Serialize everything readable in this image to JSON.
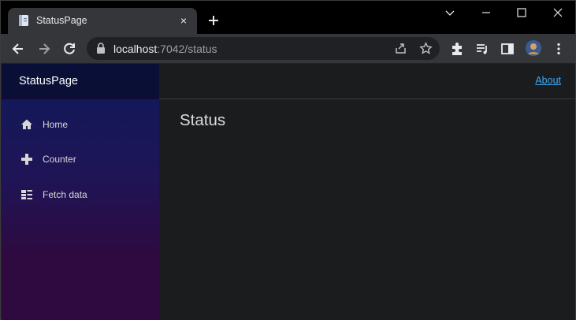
{
  "browser": {
    "tab": {
      "title": "StatusPage",
      "close_glyph": "×"
    },
    "address": {
      "host": "localhost",
      "path": ":7042/status"
    },
    "icons": {
      "favicon": "page-icon",
      "newtab": "plus-icon",
      "back": "arrow-left-icon",
      "forward": "arrow-right-icon",
      "reload": "reload-icon",
      "lock": "lock-icon",
      "share": "share-icon",
      "bookmark": "star-icon",
      "extensions": "puzzle-icon",
      "reading_list": "reading-list-icon",
      "side_panel": "side-panel-icon",
      "menu": "kebab-menu-icon"
    }
  },
  "app": {
    "brand": "StatusPage",
    "nav": [
      {
        "label": "Home",
        "icon": "home-icon"
      },
      {
        "label": "Counter",
        "icon": "plus-icon"
      },
      {
        "label": "Fetch data",
        "icon": "list-icon"
      }
    ],
    "top_link": "About",
    "page_title": "Status"
  },
  "colors": {
    "link": "#3da8f5",
    "sidebar_top": "#0f1a5a",
    "sidebar_bottom": "#2e0a40",
    "content_bg": "#1b1c1e"
  }
}
